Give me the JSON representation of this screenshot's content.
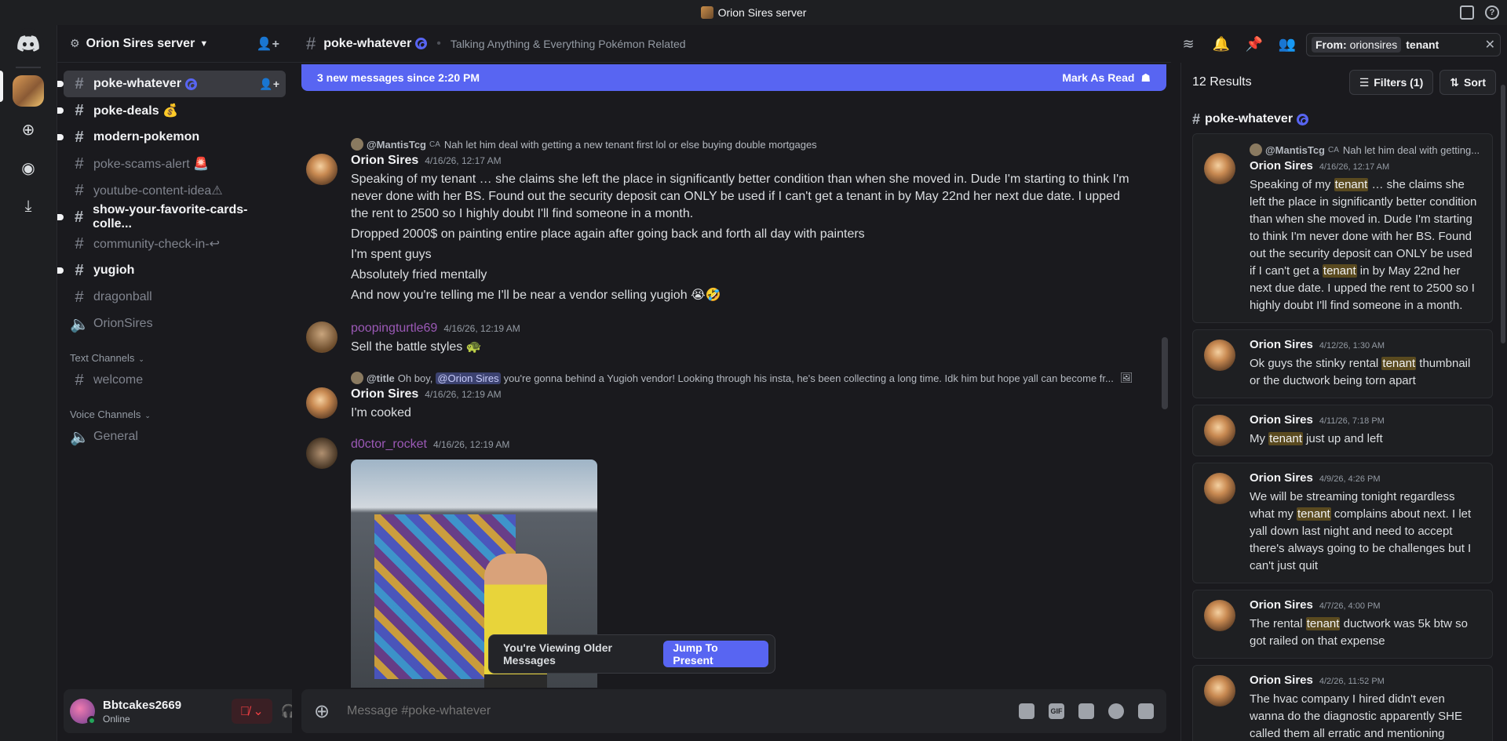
{
  "window": {
    "title": "Orion Sires server"
  },
  "server": {
    "name": "Orion Sires server"
  },
  "channels": [
    {
      "name": "poke-whatever",
      "state": "active",
      "spiral": true
    },
    {
      "name": "poke-deals 💰",
      "state": "unread"
    },
    {
      "name": "modern-pokemon",
      "state": "unread"
    },
    {
      "name": "poke-scams-alert 🚨",
      "state": "read"
    },
    {
      "name": "youtube-content-idea⚠",
      "state": "read"
    },
    {
      "name": "show-your-favorite-cards-colle...",
      "state": "unread"
    },
    {
      "name": "community-check-in-↩",
      "state": "read"
    },
    {
      "name": "yugioh",
      "state": "unread"
    },
    {
      "name": "dragonball",
      "state": "read"
    },
    {
      "name": "OrionSires",
      "state": "read",
      "voice": true
    }
  ],
  "categories": {
    "text": {
      "label": "Text Channels",
      "channels": [
        "welcome"
      ]
    },
    "voice": {
      "label": "Voice Channels",
      "channels": [
        "General"
      ]
    }
  },
  "user": {
    "name": "Bbtcakes2669",
    "status": "Online"
  },
  "chat": {
    "channel": "poke-whatever",
    "topic": "Talking Anything & Everything Pokémon Related",
    "new_messages": "3 new messages since 2:20 PM",
    "mark_read": "Mark As Read",
    "composer_placeholder": "Message #poke-whatever",
    "older_notice": "You're Viewing Older Messages",
    "jump_label": "Jump To Present"
  },
  "messages": [
    {
      "reply_author": "@MantisTcg",
      "reply_tag": "CA",
      "reply_text": "Nah let him deal with getting a new tenant first lol or else buying double mortgages",
      "author": "Orion Sires",
      "timestamp": "4/16/26, 12:17 AM",
      "lines": [
        "Speaking of my tenant … she claims she left the place in significantly better condition than when she moved in. Dude I'm starting to think I'm never done with her BS. Found out the security deposit can ONLY be used if I can't get a tenant in by May 22nd her next due date. I upped the rent to 2500 so I highly doubt I'll find someone in a month.",
        "Dropped 2000$ on painting entire place again after going back and forth all day with painters",
        "I'm spent guys",
        "Absolutely fried mentally",
        "And now you're telling me I'll be near a vendor selling yugioh 😭🤣"
      ]
    },
    {
      "author": "poopingturtle69",
      "timestamp": "4/16/26, 12:19 AM",
      "lines": [
        "Sell the battle styles 🐢"
      ]
    },
    {
      "reply_author": "@title",
      "reply_text_before": "Oh boy,",
      "reply_mention": "@Orion Sires",
      "reply_text": "you're gonna behind a Yugioh vendor! Looking through his insta, he's been collecting a long time. Idk him but hope yall can become fr...",
      "author": "Orion Sires",
      "timestamp": "4/16/26, 12:19 AM",
      "lines": [
        "I'm cooked"
      ]
    },
    {
      "author": "d0ctor_rocket",
      "timestamp": "4/16/26, 12:19 AM"
    }
  ],
  "search": {
    "filter_label": "From:",
    "filter_value": "orionsires",
    "query": "tenant",
    "results_count": "12 Results",
    "filters_label": "Filters (1)",
    "sort_label": "Sort",
    "channel": "poke-whatever",
    "results": [
      {
        "reply_author": "@MantisTcg",
        "reply_tag": "CA",
        "reply_text": "Nah let him deal with getting...",
        "author": "Orion Sires",
        "timestamp": "4/16/26, 12:17 AM",
        "parts": [
          "Speaking of my ",
          "tenant",
          " … she claims she left the place in significantly better condition than when she moved in. Dude I'm starting to think I'm never done with her BS. Found out the security deposit can ONLY be used if I can't get a ",
          "tenant",
          " in by May 22nd her next due date. I upped the rent to 2500 so I highly doubt I'll find someone in a month."
        ]
      },
      {
        "author": "Orion Sires",
        "timestamp": "4/12/26, 1:30 AM",
        "parts": [
          "Ok guys the stinky rental ",
          "tenant",
          " thumbnail or the ductwork being torn apart"
        ]
      },
      {
        "author": "Orion Sires",
        "timestamp": "4/11/26, 7:18 PM",
        "parts": [
          "My ",
          "tenant",
          " just up and left"
        ]
      },
      {
        "author": "Orion Sires",
        "timestamp": "4/9/26, 4:26 PM",
        "parts": [
          "We will be streaming tonight regardless what my ",
          "tenant",
          " complains about next. I let yall down last night and need to accept there's always going to be challenges but I can't just quit"
        ]
      },
      {
        "author": "Orion Sires",
        "timestamp": "4/7/26, 4:00 PM",
        "parts": [
          "The rental ",
          "tenant",
          " ductwork was 5k btw so got railed on that expense"
        ]
      },
      {
        "author": "Orion Sires",
        "timestamp": "4/2/26, 11:52 PM",
        "parts": [
          "The hvac company I hired didn't even wanna do the diagnostic apparently SHE called them all erratic and mentioning"
        ]
      }
    ]
  },
  "colors": {
    "accent": "#5865f2",
    "highlight": "#5a4a1f",
    "online": "#23a55a",
    "muted": "#f23f43"
  }
}
